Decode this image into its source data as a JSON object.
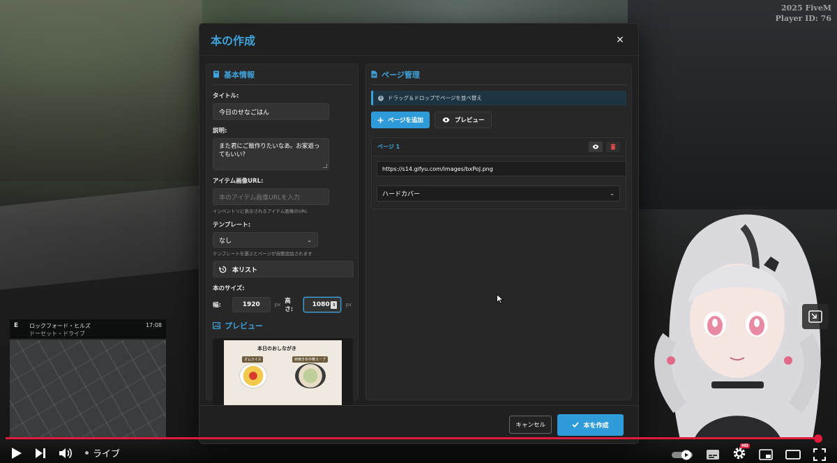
{
  "hud": {
    "line1": "2025 FiveM",
    "line2": "Player ID: 76"
  },
  "minimap": {
    "compass": "E",
    "street": "ロックフォード・ヒルズ",
    "area": "ドーセット・ドライブ",
    "time": "17:08"
  },
  "modal": {
    "title": "本の作成",
    "close_label": "×",
    "basic_info": {
      "heading": "基本情報",
      "title_label": "タイトル:",
      "title_value": "今日のせなごはん",
      "desc_label": "説明:",
      "desc_value": "また君にご飯作りたいなあ。お家遊ってもいい？",
      "image_url_label": "アイテム画像URL:",
      "image_url_placeholder": "本のアイテム画像URLを入力",
      "image_url_hint": "インベントリに表示されるアイテム画像のURL",
      "template_label": "テンプレート:",
      "template_value": "なし",
      "template_hint": "テンプレートを選ぶとページが自動追加されます",
      "booklist_button": "本リスト",
      "size_label": "本のサイズ:",
      "width_label": "幅:",
      "width_value": "1920",
      "height_label": "高さ:",
      "height_value": "1080",
      "unit": "px"
    },
    "preview": {
      "heading": "プレビュー",
      "image_title": "本日のおしながき",
      "tag_left": "オムライス",
      "tag_right": "卵焼き冬中華スープ"
    },
    "pages": {
      "heading": "ページ管理",
      "info": "ドラッグ＆ドロップでページを並べ替え",
      "add_button": "ページを追加",
      "preview_button": "プレビュー",
      "items": [
        {
          "label": "ページ 1",
          "url": "https://s14.gifyu.com/images/bxPoJ.png",
          "cover": "ハードカバー"
        }
      ]
    },
    "footer": {
      "cancel": "キャンセル",
      "create": "本を作成"
    }
  },
  "player": {
    "live_label": "ライブ",
    "hd_badge": "HD"
  },
  "colors": {
    "accent": "#3fa3db",
    "danger": "#e24b4b",
    "progress": "#e21b3c"
  }
}
